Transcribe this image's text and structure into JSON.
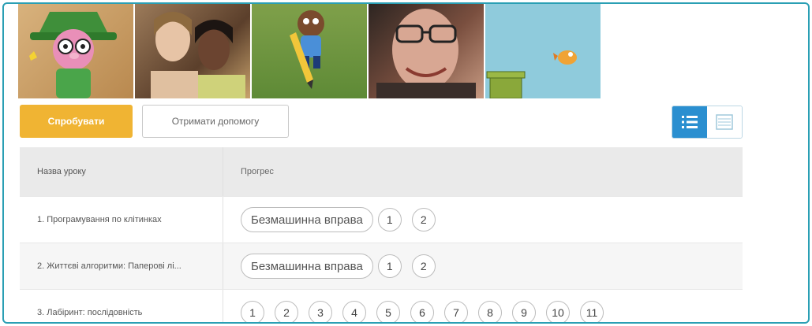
{
  "thumbnails": [
    {
      "name": "wizard-character"
    },
    {
      "name": "two-girls-photo"
    },
    {
      "name": "boy-with-pencil-character"
    },
    {
      "name": "man-glasses-photo"
    },
    {
      "name": "flappy-game-scene"
    }
  ],
  "actions": {
    "try_label": "Спробувати",
    "help_label": "Отримати допомогу"
  },
  "view_toggle": {
    "active": "list",
    "icons": [
      "list-detail-icon",
      "list-compact-icon"
    ]
  },
  "table": {
    "headers": [
      "Назва уроку",
      "Прогрес"
    ],
    "rows": [
      {
        "title": "1. Програмування по клітинках",
        "unplugged": "Безмашинна вправа",
        "levels": [
          "1",
          "2"
        ]
      },
      {
        "title": "2. Життєві алгоритми: Паперові лі...",
        "unplugged": "Безмашинна вправа",
        "levels": [
          "1",
          "2"
        ]
      },
      {
        "title": "3. Лабіринт: послідовність",
        "unplugged": "",
        "levels": [
          "1",
          "2",
          "3",
          "4",
          "5",
          "6",
          "7",
          "8",
          "9",
          "10",
          "11"
        ]
      }
    ]
  },
  "colors": {
    "accent": "#2a8fd0",
    "try": "#f0b433",
    "frame": "#2a9fb4"
  }
}
